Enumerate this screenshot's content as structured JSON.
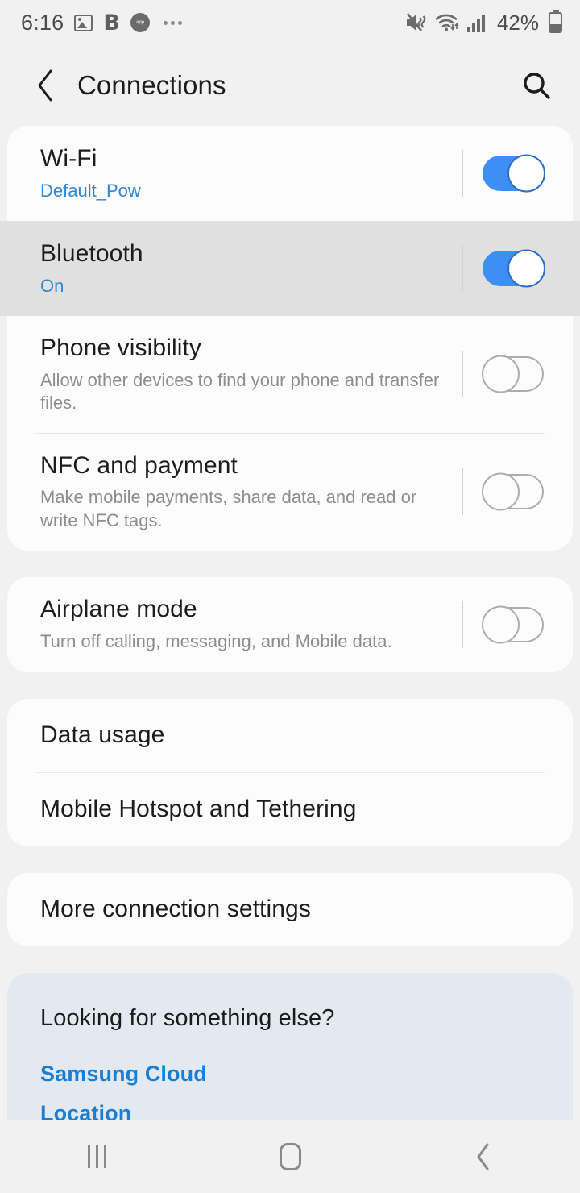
{
  "status_bar": {
    "clock": "6:16",
    "left_icons": [
      {
        "name": "photo-icon",
        "label": "photo"
      },
      {
        "name": "bold-b-icon",
        "label": "B"
      },
      {
        "name": "app-badge-icon",
        "label": "app"
      },
      {
        "name": "more-notifications-icon",
        "label": "more"
      }
    ],
    "right_icons": [
      {
        "name": "mute-vibrate-icon",
        "label": "mute"
      },
      {
        "name": "wifi-icon",
        "label": "wifi"
      },
      {
        "name": "signal-bars-icon",
        "label": "signal"
      }
    ],
    "battery_percent": "42%"
  },
  "app_bar": {
    "back_label": "Back",
    "title": "Connections",
    "search_label": "Search"
  },
  "colors": {
    "accent_blue": "#3d8ef5",
    "link_blue": "#1a7fd4",
    "subtitle_blue": "#2e86d9",
    "page_background": "#f1f1f1",
    "card_background": "#fcfcfc",
    "pressed_row": "#e0e0e0",
    "suggest_card": "#e2e9f1"
  },
  "sections": {
    "connectivity": [
      {
        "name": "wifi",
        "title": "Wi-Fi",
        "subtitle": "Default_Pow",
        "subtitle_style": "blue",
        "toggle": "on",
        "pressed": false
      },
      {
        "name": "bluetooth",
        "title": "Bluetooth",
        "subtitle": "On",
        "subtitle_style": "blue",
        "toggle": "on",
        "pressed": true
      },
      {
        "name": "phone-visibility",
        "title": "Phone visibility",
        "subtitle": "Allow other devices to find your phone and transfer files.",
        "subtitle_style": "gray",
        "toggle": "off",
        "pressed": false
      },
      {
        "name": "nfc-and-payment",
        "title": "NFC and payment",
        "subtitle": "Make mobile payments, share data, and read or write NFC tags.",
        "subtitle_style": "gray",
        "toggle": "off",
        "pressed": false
      }
    ],
    "airplane": [
      {
        "name": "airplane-mode",
        "title": "Airplane mode",
        "subtitle": "Turn off calling, messaging, and Mobile data.",
        "subtitle_style": "gray",
        "toggle": "off",
        "pressed": false
      }
    ],
    "data": [
      {
        "name": "data-usage",
        "title": "Data usage"
      },
      {
        "name": "mobile-hotspot-and-tethering",
        "title": "Mobile Hotspot and Tethering"
      }
    ],
    "more": [
      {
        "name": "more-connection-settings",
        "title": "More connection settings"
      }
    ]
  },
  "suggestions": {
    "title": "Looking for something else?",
    "links": [
      {
        "name": "samsung-cloud",
        "label": "Samsung Cloud"
      },
      {
        "name": "location",
        "label": "Location"
      }
    ]
  },
  "nav_bar": {
    "recents_label": "Recents",
    "home_label": "Home",
    "back_label": "Back"
  }
}
